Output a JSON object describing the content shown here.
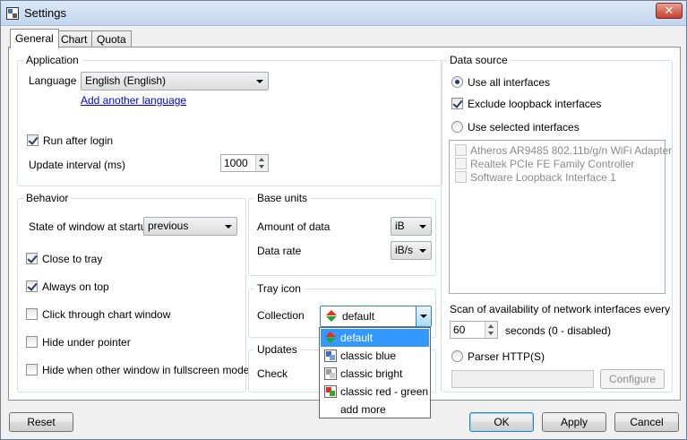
{
  "window": {
    "title": "Settings",
    "close_glyph": "✕"
  },
  "tabs": [
    {
      "label": "General",
      "active": true
    },
    {
      "label": "Chart",
      "active": false
    },
    {
      "label": "Quota",
      "active": false
    }
  ],
  "application": {
    "title": "Application",
    "language_label": "Language",
    "language_value": "English (English)",
    "add_language_link": "Add another language",
    "run_after_login": "Run after login",
    "update_interval_label": "Update interval (ms)",
    "update_interval_value": "1000"
  },
  "behavior": {
    "title": "Behavior",
    "state_label": "State of window at startup",
    "state_value": "previous",
    "close_to_tray": "Close to tray",
    "always_on_top": "Always on top",
    "click_through": "Click through chart window",
    "hide_under_pointer": "Hide under pointer",
    "hide_fullscreen": "Hide when other window in fullscreen mode"
  },
  "base_units": {
    "title": "Base units",
    "amount_label": "Amount of data",
    "amount_value": "iB",
    "rate_label": "Data rate",
    "rate_value": "iB/s"
  },
  "tray_icon": {
    "title": "Tray icon",
    "collection_label": "Collection",
    "collection_value": "default",
    "options": [
      "default",
      "classic blue",
      "classic bright",
      "classic red - green",
      "add more"
    ]
  },
  "updates": {
    "title": "Updates",
    "check_label": "Check"
  },
  "data_source": {
    "title": "Data source",
    "use_all": "Use all interfaces",
    "exclude_loopback": "Exclude loopback interfaces",
    "use_selected": "Use selected interfaces",
    "interfaces": [
      "Atheros AR9485 802.11b/g/n WiFi Adapter",
      "Realtek PCIe FE Family Controller",
      "Software Loopback Interface 1"
    ],
    "scan_label": "Scan of availability of network interfaces every",
    "scan_value": "60",
    "scan_suffix": "seconds (0 - disabled)",
    "parser_label": "Parser HTTP(S)",
    "configure_button": "Configure"
  },
  "footer": {
    "reset": "Reset",
    "ok": "OK",
    "apply": "Apply",
    "cancel": "Cancel"
  },
  "colors": {
    "selection": "#3399ff",
    "link": "#0000ee",
    "title_bar": "#c2d6ee",
    "close_button": "#c4402b"
  }
}
